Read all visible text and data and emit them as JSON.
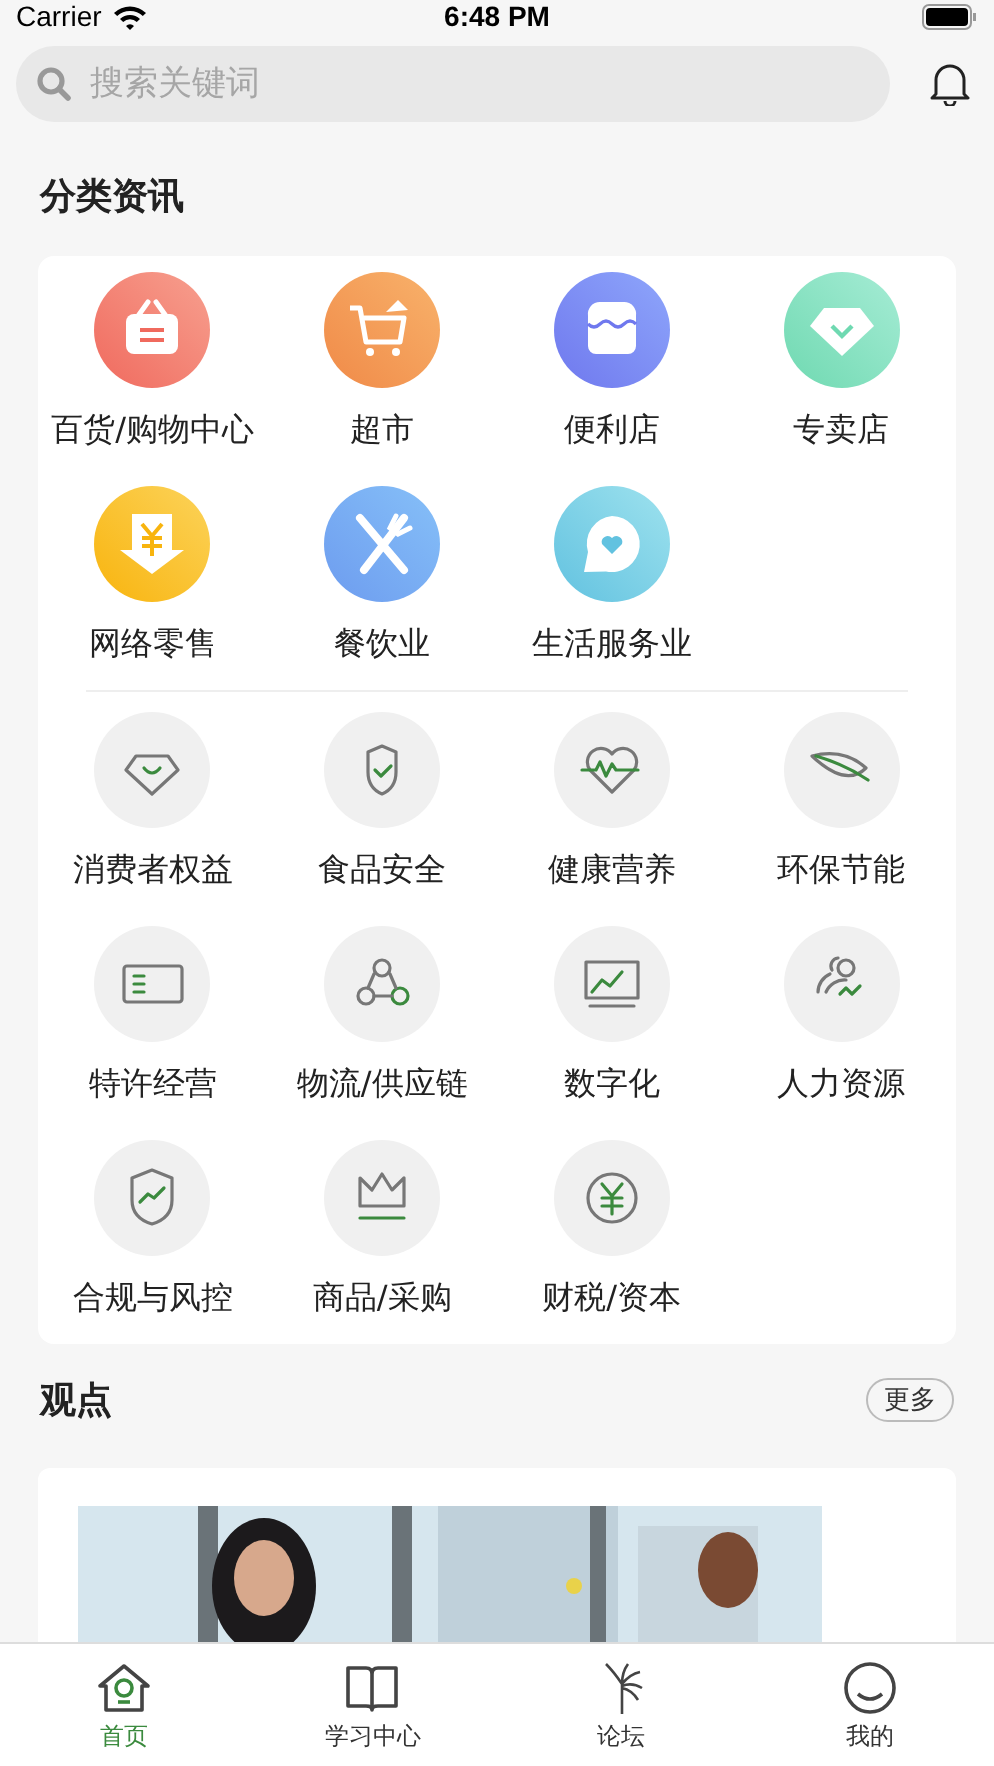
{
  "status_bar": {
    "carrier": "Carrier",
    "time": "6:48 PM"
  },
  "search": {
    "placeholder": "搜索关键词"
  },
  "categories": {
    "title": "分类资讯",
    "primary": [
      {
        "label": "百货/购物中心"
      },
      {
        "label": "超市"
      },
      {
        "label": "便利店"
      },
      {
        "label": "专卖店"
      },
      {
        "label": "网络零售"
      },
      {
        "label": "餐饮业"
      },
      {
        "label": "生活服务业"
      }
    ],
    "topics": [
      {
        "label": "消费者权益"
      },
      {
        "label": "食品安全"
      },
      {
        "label": "健康营养"
      },
      {
        "label": "环保节能"
      },
      {
        "label": "特许经营"
      },
      {
        "label": "物流/供应链"
      },
      {
        "label": "数字化"
      },
      {
        "label": "人力资源"
      },
      {
        "label": "合规与风控"
      },
      {
        "label": "商品/采购"
      },
      {
        "label": "财税/资本"
      }
    ]
  },
  "viewpoints": {
    "title": "观点",
    "more": "更多"
  },
  "tab_bar": [
    {
      "label": "首页",
      "selected": true
    },
    {
      "label": "学习中心",
      "selected": false
    },
    {
      "label": "论坛",
      "selected": false
    },
    {
      "label": "我的",
      "selected": false
    }
  ]
}
